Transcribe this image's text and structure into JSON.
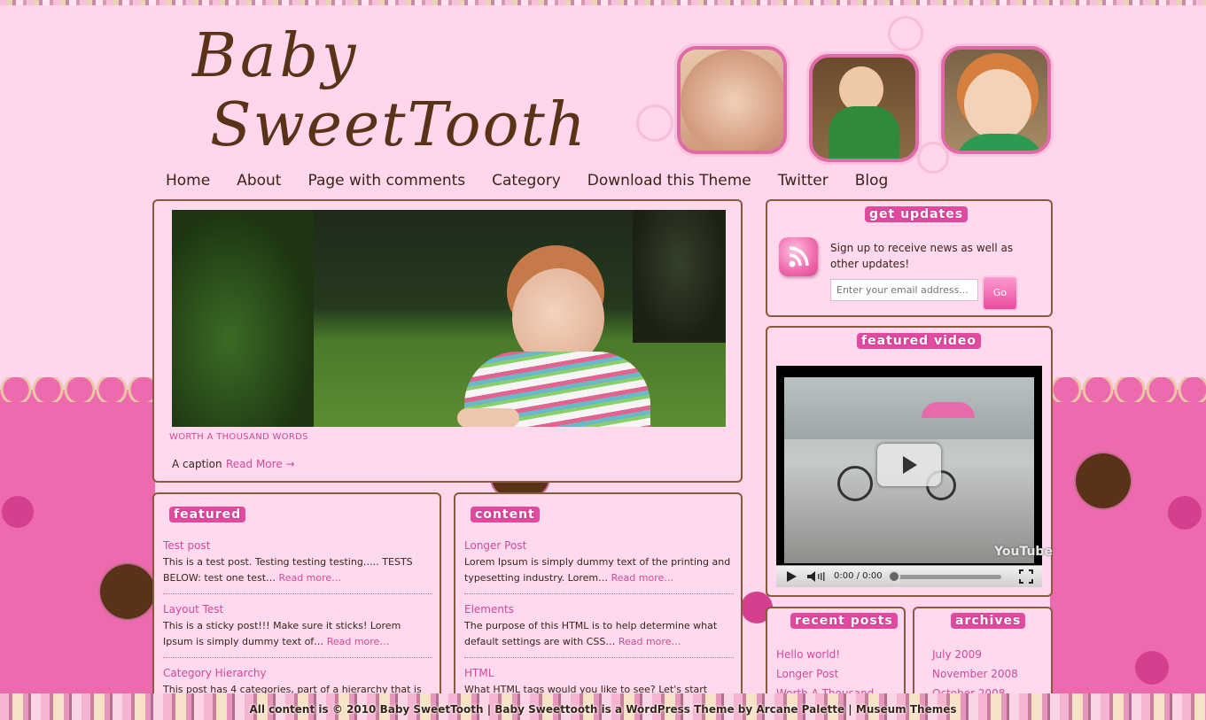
{
  "site": {
    "title_line1": "Baby",
    "title_line2": "SweetTooth"
  },
  "nav": {
    "items": [
      "Home",
      "About",
      "Page with comments",
      "Category",
      "Download this Theme",
      "Twitter",
      "Blog"
    ]
  },
  "hero": {
    "tag": "WORTH A THOUSAND WORDS",
    "caption": "A caption",
    "read_more": "Read More →"
  },
  "featured": {
    "title": "featured",
    "posts": [
      {
        "title": "Test post",
        "text": "This is a test post. Testing testing testing….. TESTS BELOW: test one test…",
        "more": "Read more…"
      },
      {
        "title": "Layout Test",
        "text": "This is a sticky post!!! Make sure it sticks! Lorem Ipsum is simply dummy text of…",
        "more": "Read more…"
      },
      {
        "title": "Category Hierarchy",
        "text": "This post has 4 categories, part of a hierarchy that is",
        "more": ""
      }
    ]
  },
  "content": {
    "title": "content",
    "posts": [
      {
        "title": "Longer Post",
        "text": "Lorem Ipsum is simply dummy text of the printing and typesetting industry. Lorem…",
        "more": "Read more…"
      },
      {
        "title": "Elements",
        "text": "The purpose of this HTML is to help determine what default settings are with CSS…",
        "more": "Read more…"
      },
      {
        "title": "HTML",
        "text": "What HTML tags would you like to see? Let's start",
        "more": ""
      }
    ]
  },
  "updates": {
    "title": "get updates",
    "text": "Sign up to receive news as well as other updates!",
    "email_placeholder": "Enter your email address...",
    "go": "Go"
  },
  "video": {
    "title": "featured video",
    "time": "0:00 / 0:00",
    "watermark": "YouTube"
  },
  "recent": {
    "title": "recent posts",
    "items": [
      "Hello world!",
      "Longer Post",
      "Worth A Thousand"
    ]
  },
  "archives": {
    "title": "archives",
    "items": [
      "July 2009",
      "November 2008",
      "October 2008"
    ]
  },
  "footer": {
    "copyright": "All content is © 2010 Baby SweetTooth",
    "theme": "Baby Sweettooth is a WordPress Theme by Arcane Palette",
    "sep": "|",
    "museum": "Museum Themes"
  },
  "colors": {
    "background": "#ffd6ec",
    "accent": "#d04a98",
    "brown": "#5a3218"
  }
}
